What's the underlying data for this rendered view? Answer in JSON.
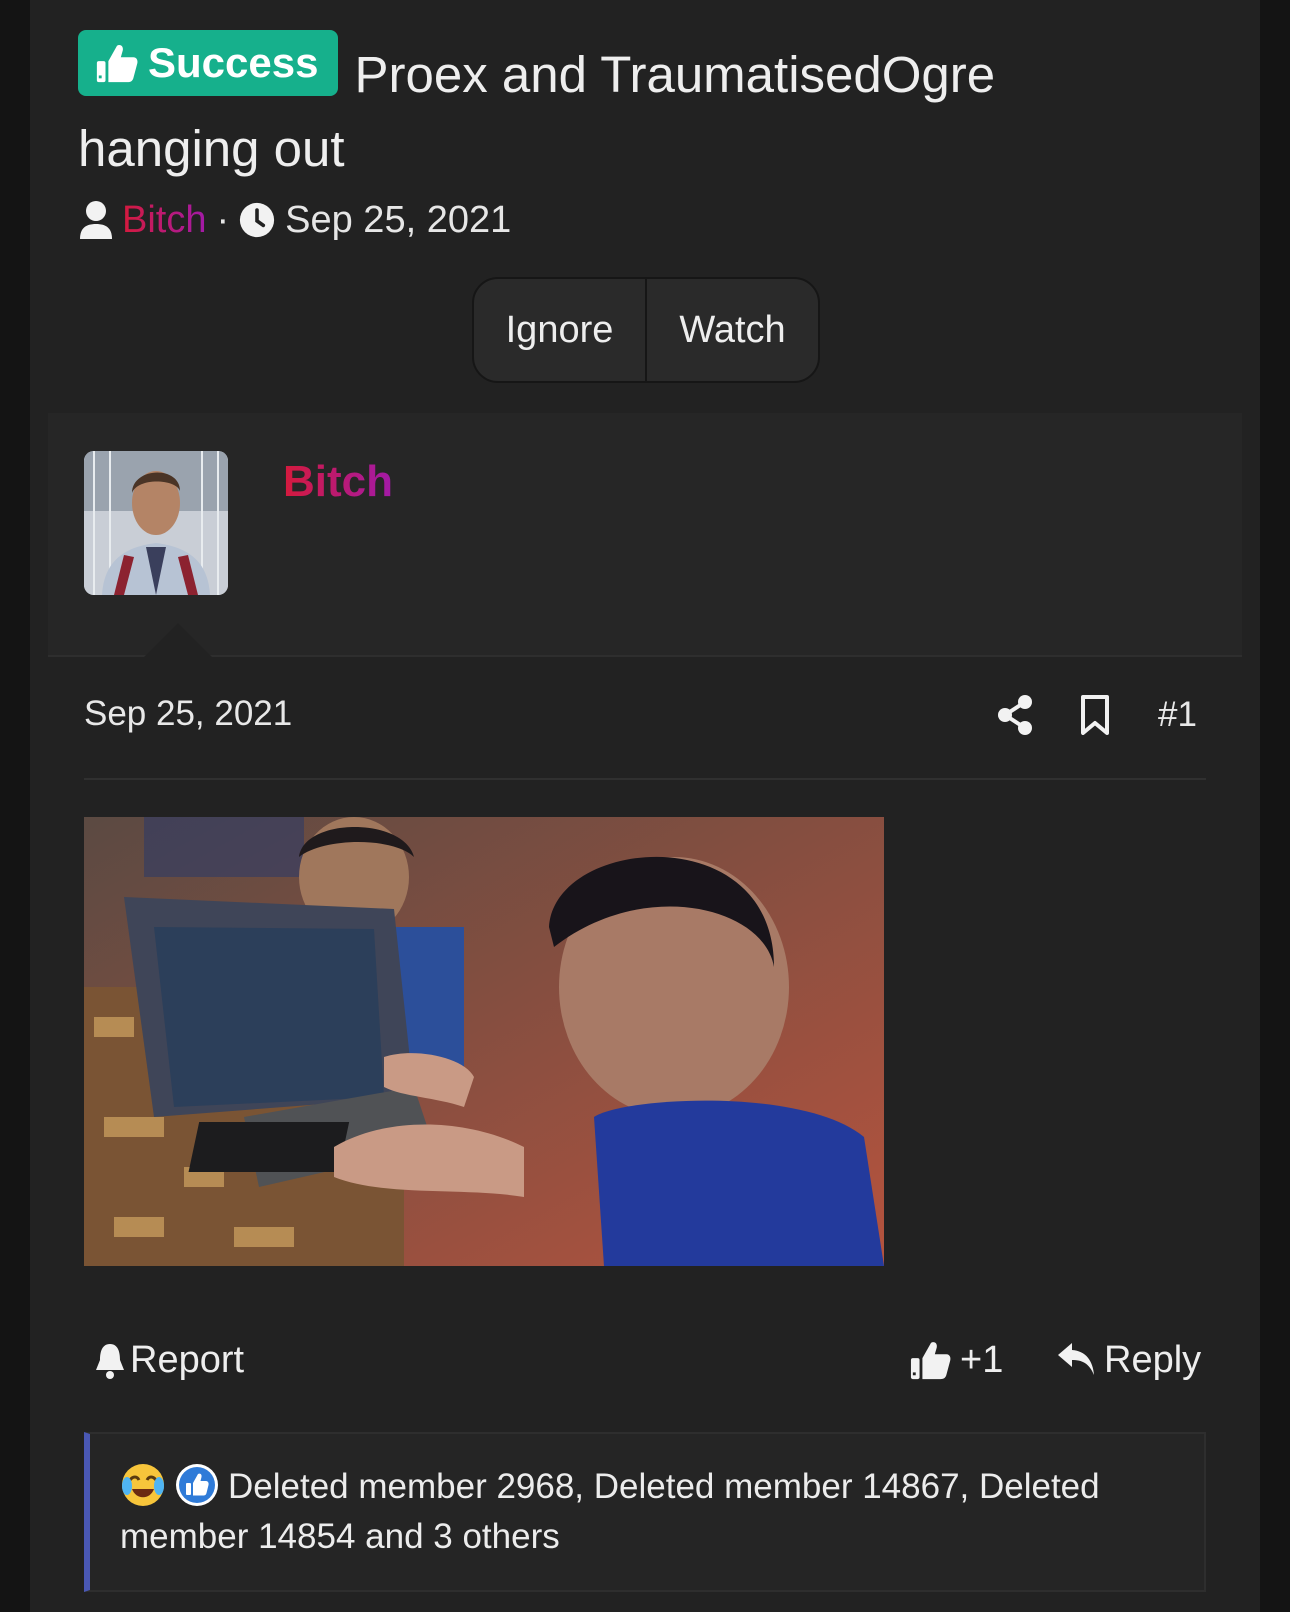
{
  "thread": {
    "prefix_label": "Success",
    "title": "Proex and TraumatisedOgre hanging out",
    "author": "Bitch",
    "separator": "·",
    "date": "Sep 25, 2021"
  },
  "actions": {
    "ignore_label": "Ignore",
    "watch_label": "Watch"
  },
  "post": {
    "user_name": "Bitch",
    "date": "Sep 25, 2021",
    "number": "#1",
    "report_label": "Report",
    "like_label": "+1",
    "reply_label": "Reply"
  },
  "reactions": {
    "text": "Deleted member 2968, Deleted member 14867, Deleted member 14854 and 3 others",
    "icons": [
      "crying-laughing-emoji",
      "like-reaction-icon"
    ]
  },
  "colors": {
    "prefix_bg": "#16b08c",
    "author_gradient_start": "#d51a3c",
    "author_gradient_end": "#a21aa8",
    "reaction_bar_accent": "#4a58b4",
    "background": "#222222"
  }
}
